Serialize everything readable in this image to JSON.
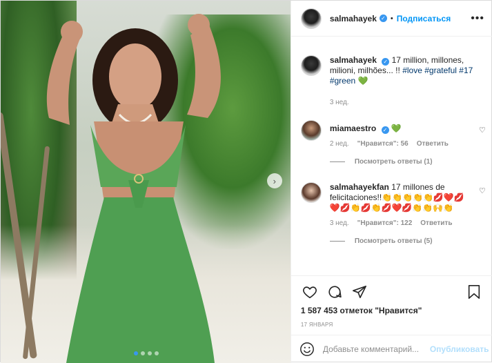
{
  "post": {
    "username": "salmahayek",
    "verified": true,
    "separator": "•",
    "follow_label": "Подписаться",
    "more_icon": "more-horizontal-icon",
    "colors": {
      "accent": "#0095f6",
      "hashtag": "#00376b",
      "muted": "#8e8e8e",
      "verified": "#3897f0"
    }
  },
  "caption": {
    "username": "salmahayek",
    "text": "17 million, millones, milioni, milhões... !!",
    "hashtags": [
      "#love",
      "#grateful",
      "#17",
      "#green"
    ],
    "emoji": "💚",
    "time": "3 нед."
  },
  "comments": [
    {
      "username": "miamaestro",
      "verified": true,
      "text": "💚",
      "time": "2 нед.",
      "likes": "\"Нравится\": 56",
      "reply_label": "Ответить",
      "view_replies": "Посмотреть ответы (1)"
    },
    {
      "username": "salmahayekfan",
      "verified": false,
      "text": "17 millones de felicitaciones!!👏👏👏👏👏💋❤️💋❤️💋👏💋👏💋❤️💋👏👏🙌👏",
      "time": "3 нед.",
      "likes": "\"Нравится\": 122",
      "reply_label": "Ответить",
      "view_replies": "Посмотреть ответы (5)"
    }
  ],
  "actions": {
    "like_icon": "heart-icon",
    "comment_icon": "comment-icon",
    "share_icon": "send-icon",
    "save_icon": "bookmark-icon",
    "likes_text": "1 587 453 отметок \"Нравится\"",
    "date": "17 ЯНВАРЯ"
  },
  "add_comment": {
    "emoji_icon": "smiley-icon",
    "placeholder": "Добавьте комментарий...",
    "publish_label": "Опубликовать"
  },
  "carousel": {
    "slide_count": 4,
    "active_slide": 1,
    "next_icon": "chevron-right-icon"
  }
}
